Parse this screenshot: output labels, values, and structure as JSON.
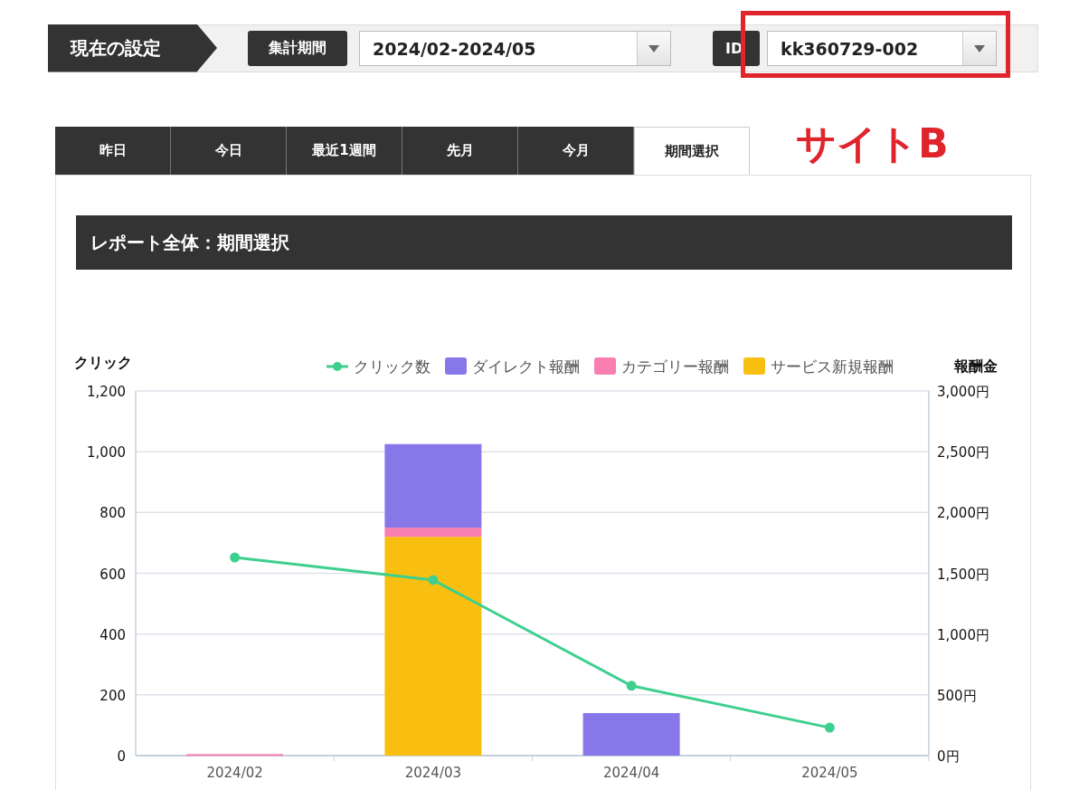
{
  "settings_bar": {
    "title": "現在の設定",
    "period_label": "集計期間",
    "period_value": "2024/02-2024/05",
    "id_label": "ID",
    "id_value": "kk360729-002"
  },
  "annotation": {
    "label": "サイトB"
  },
  "tabs": [
    {
      "label": "昨日",
      "selected": false
    },
    {
      "label": "今日",
      "selected": false
    },
    {
      "label": "最近1週間",
      "selected": false
    },
    {
      "label": "先月",
      "selected": false
    },
    {
      "label": "今月",
      "selected": false
    },
    {
      "label": "期間選択",
      "selected": true
    }
  ],
  "report": {
    "title": "レポート全体：期間選択",
    "chart_data": {
      "type": "bar",
      "stacked": true,
      "ylabel": "クリック",
      "y2label": "報酬金",
      "categories": [
        "2024/02",
        "2024/03",
        "2024/04",
        "2024/05"
      ],
      "ylim": [
        0,
        1200
      ],
      "yticks": [
        {
          "value": 0,
          "label": "0"
        },
        {
          "value": 200,
          "label": "200"
        },
        {
          "value": 400,
          "label": "400"
        },
        {
          "value": 600,
          "label": "600"
        },
        {
          "value": 800,
          "label": "800"
        },
        {
          "value": 1000,
          "label": "1,000"
        },
        {
          "value": 1200,
          "label": "1,200"
        }
      ],
      "grid": true,
      "legend": true,
      "y2lim": [
        0,
        3000
      ],
      "y2ticks": [
        {
          "value": 0,
          "label": "0円"
        },
        {
          "value": 500,
          "label": "500円"
        },
        {
          "value": 1000,
          "label": "1,000円"
        },
        {
          "value": 1500,
          "label": "1,500円"
        },
        {
          "value": 2000,
          "label": "2,000円"
        },
        {
          "value": 2500,
          "label": "2,500円"
        },
        {
          "value": 3000,
          "label": "3,000円"
        }
      ],
      "series": [
        {
          "name": "クリック数",
          "type": "line",
          "marker": true,
          "color": "#3ecf8e",
          "values": [
            652,
            578,
            230,
            92
          ]
        },
        {
          "name": "ダイレクト報酬",
          "type": "bar",
          "color": "#8877e8",
          "values": [
            0,
            275,
            140,
            0
          ]
        },
        {
          "name": "カテゴリー報酬",
          "type": "bar",
          "color": "#f97fb0",
          "values": [
            5,
            30,
            0,
            0
          ]
        },
        {
          "name": "サービス新規報酬",
          "type": "bar",
          "color": "#f8bf10",
          "values": [
            0,
            720,
            0,
            0
          ]
        }
      ]
    }
  }
}
